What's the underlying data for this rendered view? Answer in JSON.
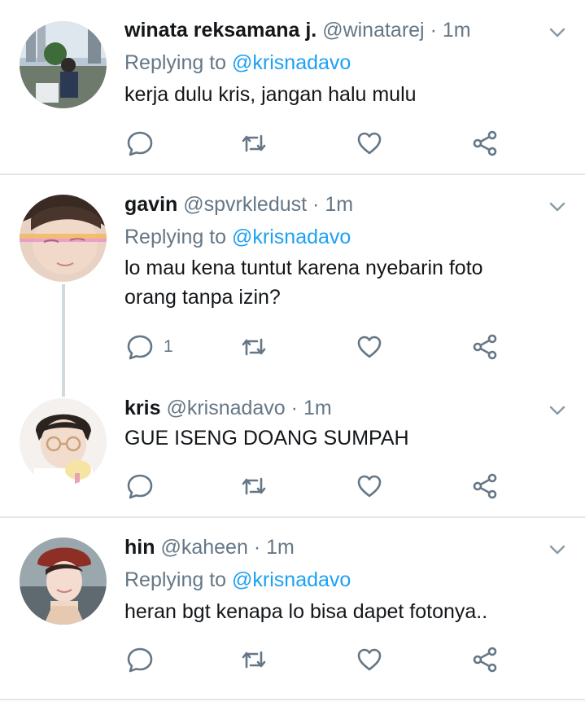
{
  "tweets": [
    {
      "name": "winata reksamana j.",
      "handle": "@winatarej",
      "dot": "·",
      "time": "1m",
      "reply_prefix": "Replying to",
      "reply_mention": "@krisnadavo",
      "text": "kerja dulu kris, jangan halu mulu",
      "reply_count": ""
    },
    {
      "name": "gavin",
      "handle": "@spvrkledust",
      "dot": "·",
      "time": "1m",
      "reply_prefix": "Replying to",
      "reply_mention": "@krisnadavo",
      "text": "lo mau kena tuntut karena nyebarin foto orang tanpa izin?",
      "reply_count": "1"
    },
    {
      "name": "kris",
      "handle": "@krisnadavo",
      "dot": "·",
      "time": "1m",
      "text": "GUE ISENG DOANG SUMPAH",
      "reply_count": ""
    },
    {
      "name": "hin",
      "handle": "@kaheen",
      "dot": "·",
      "time": "1m",
      "reply_prefix": "Replying to",
      "reply_mention": "@krisnadavo",
      "text": "heran bgt kenapa lo bisa dapet fotonya..",
      "reply_count": ""
    }
  ],
  "colors": {
    "accent": "#1da1f2",
    "secondary_text": "#657786",
    "primary_text": "#14171a",
    "icon": "#657786",
    "divider": "#e1e8ed"
  },
  "icons": [
    "reply-icon",
    "retweet-icon",
    "like-icon",
    "share-icon",
    "chevron-down-icon"
  ]
}
